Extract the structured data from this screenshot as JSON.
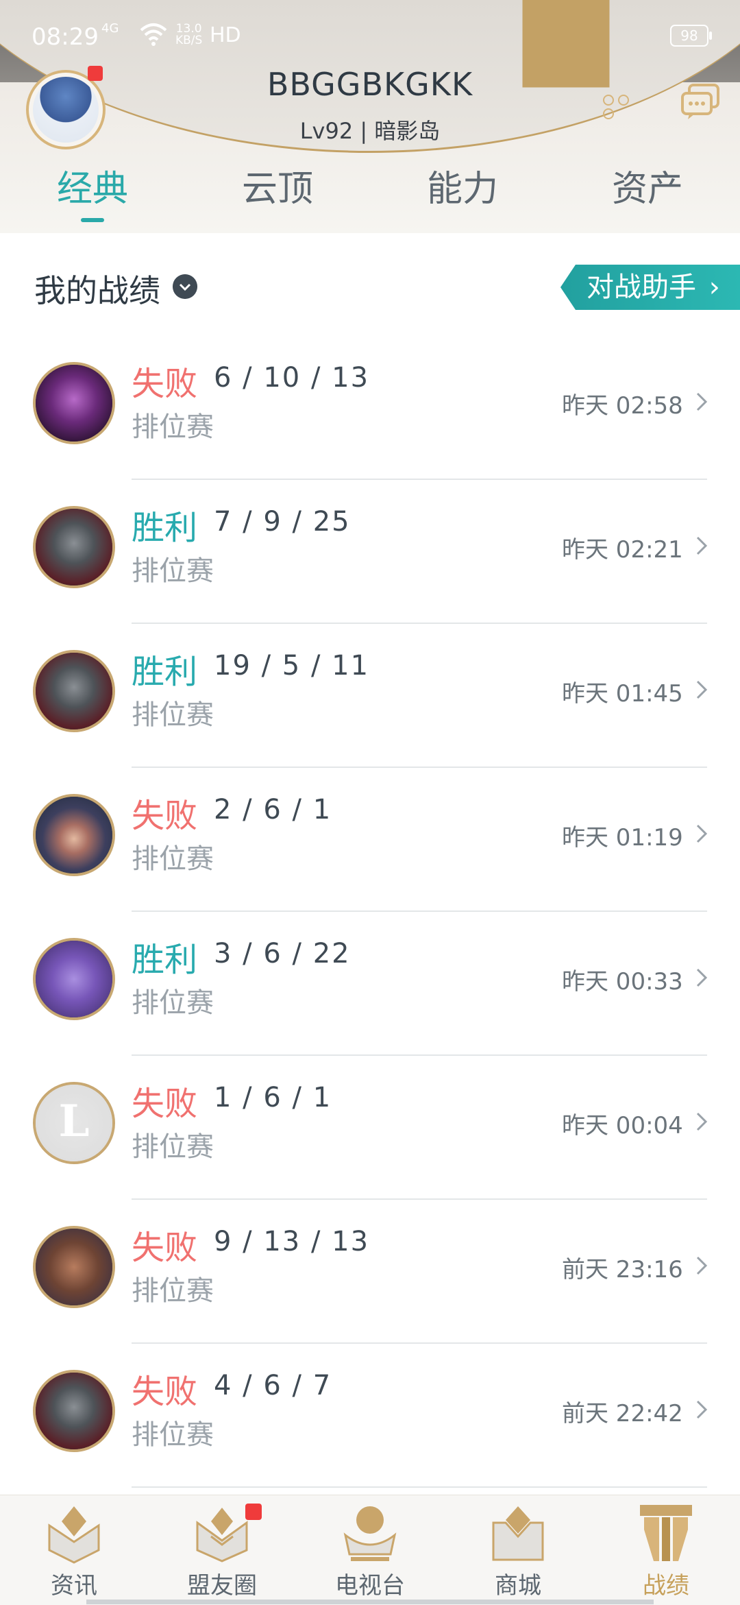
{
  "status_bar": {
    "time": "08:29",
    "signal": "4G",
    "speed_value": "13.0",
    "speed_unit": "KB/S",
    "hd": "HD",
    "battery": "98"
  },
  "profile": {
    "username": "BBGGBKGKK",
    "level_region": "Lv92 | 暗影岛"
  },
  "tabs": [
    {
      "label": "经典",
      "active": true
    },
    {
      "label": "云顶",
      "active": false
    },
    {
      "label": "能力",
      "active": false
    },
    {
      "label": "资产",
      "active": false
    }
  ],
  "section": {
    "title": "我的战绩",
    "assistant_button": "对战助手"
  },
  "matches": [
    {
      "result": "失败",
      "outcome": "lose",
      "kda": "6 / 10 / 13",
      "mode": "排位赛",
      "time": "昨天 02:58",
      "champion_icon": "champion-morgana-icon"
    },
    {
      "result": "胜利",
      "outcome": "win",
      "kda": "7 / 9 / 25",
      "mode": "排位赛",
      "time": "昨天 02:21",
      "champion_icon": "champion-masked-icon"
    },
    {
      "result": "胜利",
      "outcome": "win",
      "kda": "19 / 5 / 11",
      "mode": "排位赛",
      "time": "昨天 01:45",
      "champion_icon": "champion-masked-icon"
    },
    {
      "result": "失败",
      "outcome": "lose",
      "kda": "2 / 6 / 1",
      "mode": "排位赛",
      "time": "昨天 01:19",
      "champion_icon": "champion-caitlyn-icon"
    },
    {
      "result": "胜利",
      "outcome": "win",
      "kda": "3 / 6 / 22",
      "mode": "排位赛",
      "time": "昨天 00:33",
      "champion_icon": "champion-purple-icon"
    },
    {
      "result": "失败",
      "outcome": "lose",
      "kda": "1 / 6 / 1",
      "mode": "排位赛",
      "time": "昨天 00:04",
      "champion_icon": "champion-placeholder-icon"
    },
    {
      "result": "失败",
      "outcome": "lose",
      "kda": "9 / 13 / 13",
      "mode": "排位赛",
      "time": "前天 23:16",
      "champion_icon": "champion-lucian-icon"
    },
    {
      "result": "失败",
      "outcome": "lose",
      "kda": "4 / 6 / 7",
      "mode": "排位赛",
      "time": "前天 22:42",
      "champion_icon": "champion-masked-icon"
    }
  ],
  "bottom_nav": [
    {
      "label": "资讯",
      "icon": "news-icon",
      "active": false,
      "badge": false
    },
    {
      "label": "盟友圈",
      "icon": "friends-circle-icon",
      "active": false,
      "badge": true
    },
    {
      "label": "电视台",
      "icon": "tv-icon",
      "active": false,
      "badge": false
    },
    {
      "label": "商城",
      "icon": "shop-icon",
      "active": false,
      "badge": false
    },
    {
      "label": "战绩",
      "icon": "record-icon",
      "active": true,
      "badge": false
    }
  ],
  "colors": {
    "accent_teal": "#2aa9a9",
    "lose_red": "#f0716f",
    "win_teal": "#28aaae",
    "gold": "#c6a05a",
    "badge_red": "#ef3b3b"
  }
}
